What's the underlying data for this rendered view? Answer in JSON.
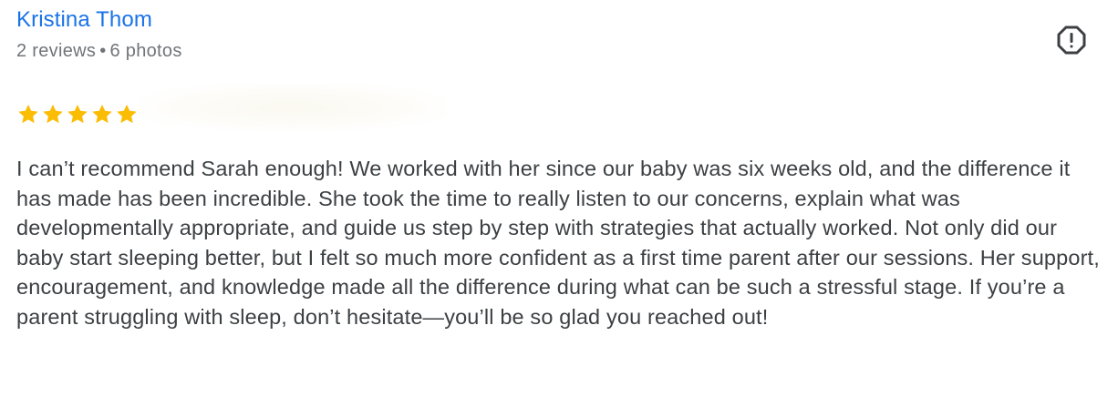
{
  "reviewer": {
    "name": "Kristina Thom",
    "reviews": "2 reviews",
    "separator": "•",
    "photos": "6 photos"
  },
  "rating": {
    "stars": 5,
    "max": 5,
    "star_color": "#fbbc04"
  },
  "report_icon": "report-flag-icon",
  "review": {
    "text": "I can’t recommend Sarah enough! We worked with her since our baby was six weeks old, and the difference it has made has been incredible. She took the time to really listen to our concerns, explain what was developmentally appropriate, and guide us step by step with strategies that actually worked. Not only did our baby start sleeping better, but I felt so much more confident as a first time parent after our sessions. Her support, encouragement, and knowledge made all the difference during what can be such a stressful stage. If you’re a parent struggling with sleep, don’t hesitate—you’ll be so glad you reached out!"
  },
  "colors": {
    "name_link": "#1a73e8",
    "meta_text": "#70757a",
    "body_text": "#3c4043",
    "icon": "#3c4043"
  }
}
